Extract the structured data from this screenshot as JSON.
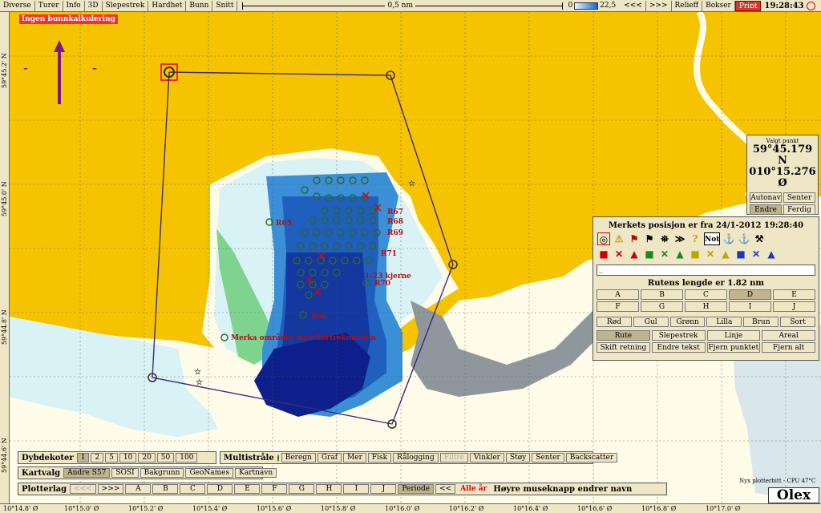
{
  "toolbar": {
    "items": [
      "Diverse",
      "Turer",
      "Info",
      "3D",
      "Slepestrek",
      "Hardhet",
      "Bunn",
      "Snitt"
    ],
    "scale_label": "0,5 nm",
    "depth_min": "0",
    "depth_max": "22,5",
    "nav_prev": "<<<",
    "nav_next": ">>>",
    "relieff": "Relieff",
    "bokser": "Bokser",
    "print": "Print",
    "clock": "19:28:43"
  },
  "alert": "Ingen bunnkalkulering",
  "lat_labels": [
    "59°45.2' N",
    "59°45.0' N",
    "59°44.8' N",
    "59°44.6' N"
  ],
  "lon_labels": [
    "10°14.8' Ø",
    "10°15.0' Ø",
    "10°15.2' Ø",
    "10°15.4' Ø",
    "10°15.6' Ø",
    "10°15.8' Ø",
    "10°16.0' Ø",
    "10°16.2' Ø",
    "10°16.4' Ø",
    "10°16.6' Ø",
    "10°16.8' Ø",
    "10°17.0' Ø"
  ],
  "valgt_punkt": {
    "caption": "Valgt punkt",
    "lat": "59°45.179 N",
    "lon": "010°15.276 Ø",
    "buttons": [
      "Autonav",
      "Senter",
      "Endre",
      "Ferdig"
    ]
  },
  "marks_panel": {
    "title": "Merkets posisjon er fra 24/1-2012 19:28:40",
    "text_value": "_",
    "route_length": "Rutens lengde er 1.82 nm",
    "letters": [
      "A",
      "B",
      "C",
      "D",
      "E",
      "F",
      "G",
      "H",
      "I",
      "J"
    ],
    "colors": [
      "Rød",
      "Gul",
      "Grønn",
      "Lilla",
      "Brun",
      "Sort"
    ],
    "actions": [
      "Rute",
      "Slepestrek",
      "Linje",
      "Areal",
      "Skift retning",
      "Endre tekst",
      "Fjern punktet",
      "Fjern alt"
    ],
    "icons_row1": [
      "◎",
      "⚠",
      "⚑",
      "⚑",
      "⛯",
      "≫",
      "?",
      "Not",
      "⚓",
      "⚓",
      "⚒"
    ],
    "icons_row2": [
      "■",
      "✕",
      "▲",
      "■",
      "✕",
      "▲",
      "■",
      "✕",
      "▲",
      "■",
      "✕",
      "▲"
    ]
  },
  "map_labels": {
    "r65": "R65",
    "r66": "R66",
    "r67": "R67",
    "r68": "R68",
    "r69": "R69",
    "r70": "R70",
    "r71": "R71",
    "kjerne": "1-23 kjerne",
    "merka": "Merka området med flørtrekomsten"
  },
  "dybdekoter": {
    "label": "Dybdekoter",
    "values": [
      "1",
      "2",
      "5",
      "10",
      "20",
      "50",
      "100"
    ]
  },
  "multistraale": {
    "label": "Multistråle",
    "items": [
      "Beregn",
      "Graf",
      "Mer",
      "Fisk",
      "Rålogging",
      "Filtre",
      "Vinkler",
      "Støy",
      "Senter",
      "Backscatter"
    ]
  },
  "kartvalg": {
    "label": "Kartvalg",
    "items": [
      "Andre S57",
      "SOSI",
      "Bakgrunn",
      "GeoNames",
      "Kartnavn"
    ]
  },
  "plotterlag": {
    "label": "Plotterlag",
    "nav": [
      "<<<",
      ">>>"
    ],
    "letters": [
      "A",
      "B",
      "C",
      "D",
      "E",
      "F",
      "G",
      "H",
      "I",
      "J"
    ],
    "periode": "Periode",
    "prev": "<<",
    "alle_aar": "Alle år",
    "hint": "Høyre museknapp endrer navn"
  },
  "status": {
    "cpu": "Nyx plotterbitt - CPU 47°C",
    "brand": "Olex"
  }
}
